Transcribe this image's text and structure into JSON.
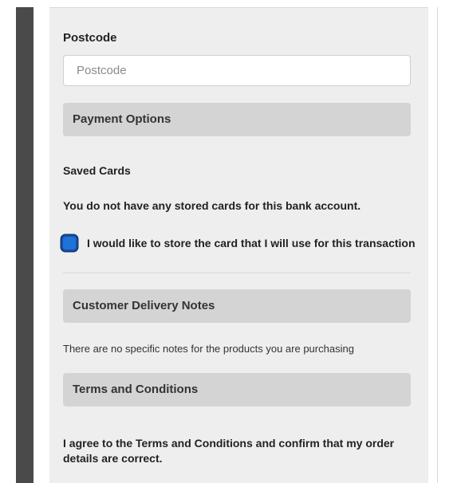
{
  "form": {
    "postcode_label": "Postcode",
    "postcode_placeholder": "Postcode",
    "postcode_value": ""
  },
  "payment": {
    "header": "Payment Options",
    "saved_cards_label": "Saved Cards",
    "no_cards_message": "You do not have any stored cards for this bank account.",
    "store_card_label": "I would like to store the card that I will use for this transaction",
    "store_card_checked": true
  },
  "delivery": {
    "header": "Customer Delivery Notes",
    "notes_message": "There are no specific notes for the products you are purchasing"
  },
  "terms": {
    "header": "Terms and Conditions",
    "agreement_text": "I agree to the Terms and Conditions and confirm that my order details are correct."
  },
  "colors": {
    "panel_background": "#eeeeee",
    "section_header_background": "#d4d4d4",
    "checkbox_accent": "#1e73d8"
  }
}
